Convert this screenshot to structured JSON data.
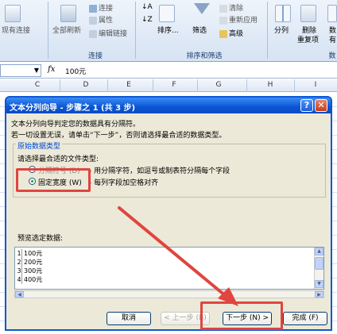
{
  "ribbon": {
    "items": {
      "existing_conn": "现有连接",
      "refresh_all": "全部刷新",
      "connections": "连接",
      "properties": "属性",
      "edit_links": "编辑链接",
      "sort": "排序...",
      "filter": "筛选",
      "clear": "清除",
      "reapply": "重新应用",
      "advanced": "高级",
      "split": "分列",
      "remove_dup_line1": "删除",
      "remove_dup_line2": "重复项",
      "data_validation_line1": "数",
      "data_validation_line2": "有"
    },
    "groups": {
      "connections": "连接",
      "sort_filter": "排序和筛选",
      "data_tools": "数"
    }
  },
  "formula_bar": {
    "fx": "fx",
    "value": "100元"
  },
  "columns": [
    "C",
    "D",
    "E",
    "F",
    "G",
    "H",
    "I"
  ],
  "dialog": {
    "title": "文本分列向导 - 步骤之 1 (共 3 步)",
    "help": "?",
    "close": "✕",
    "intro1": "文本分列向导判定您的数据具有分隔符。",
    "intro2": "若一切设置无误，请单击“下一步”，否则请选择最合适的数据类型。",
    "group_title": "原始数据类型",
    "choose_label": "请选择最合适的文件类型:",
    "options": [
      {
        "label": "分隔符号 (D)",
        "desc": "- 用分隔字符，如逗号或制表符分隔每个字段",
        "selected": false
      },
      {
        "label": "固定宽度 (W)",
        "desc": "- 每列字段加空格对齐",
        "selected": true
      }
    ],
    "preview_label": "预览选定数据:",
    "preview_rows": [
      {
        "num": "1",
        "value": "100元"
      },
      {
        "num": "2",
        "value": "200元"
      },
      {
        "num": "3",
        "value": "300元"
      },
      {
        "num": "4",
        "value": "400元"
      }
    ],
    "buttons": {
      "cancel": "取消",
      "back": "< 上一步 (B)",
      "next": "下一步 (N) >",
      "finish": "完成 (F)"
    }
  },
  "colors": {
    "annotation": "#e04540",
    "title_bar": "#0a55d4"
  }
}
